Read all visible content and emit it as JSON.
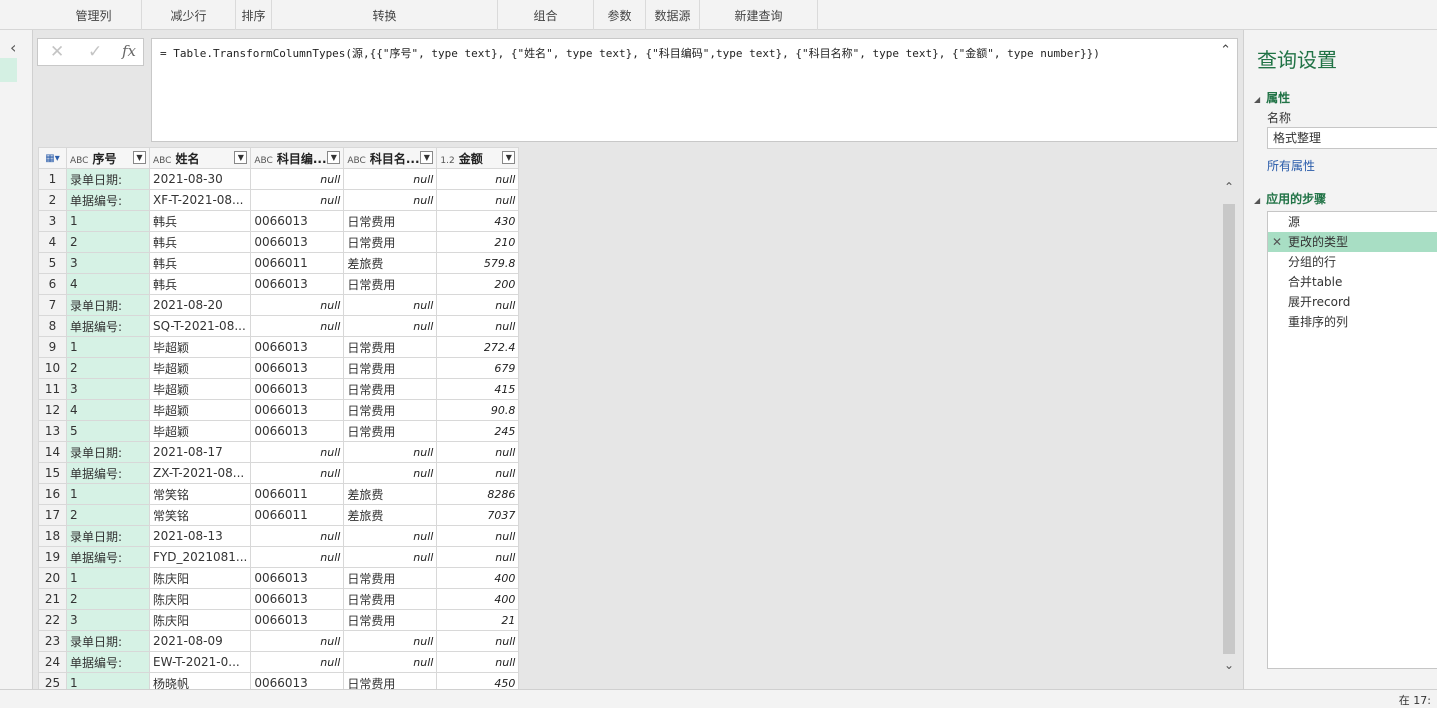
{
  "ribbon": {
    "groups": [
      "管理列",
      "减少行",
      "排序",
      "转换",
      "组合",
      "参数",
      "数据源",
      "新建查询"
    ]
  },
  "formula": {
    "cancel_icon": "✕",
    "commit_icon": "✓",
    "fx_label": "fx",
    "text": "= Table.TransformColumnTypes(源,{{\"序号\", type text}, {\"姓名\", type text}, {\"科目编码\",type text}, {\"科目名称\", type text}, {\"金额\", type number}})"
  },
  "grid": {
    "columns": [
      {
        "type": "ABC",
        "label": "序号"
      },
      {
        "type": "ABC",
        "label": "姓名"
      },
      {
        "type": "ABC",
        "label": "科目编..."
      },
      {
        "type": "ABC",
        "label": "科目名..."
      },
      {
        "type": "1.2",
        "label": "金额"
      }
    ],
    "rows": [
      [
        "1",
        "录单日期:",
        "2021-08-30",
        "null",
        "null",
        "null"
      ],
      [
        "2",
        "单据编号:",
        "XF-T-2021-08...",
        "null",
        "null",
        "null"
      ],
      [
        "3",
        "1",
        "韩兵",
        "0066013",
        "日常费用",
        "430"
      ],
      [
        "4",
        "2",
        "韩兵",
        "0066013",
        "日常费用",
        "210"
      ],
      [
        "5",
        "3",
        "韩兵",
        "0066011",
        "差旅费",
        "579.8"
      ],
      [
        "6",
        "4",
        "韩兵",
        "0066013",
        "日常费用",
        "200"
      ],
      [
        "7",
        "录单日期:",
        "2021-08-20",
        "null",
        "null",
        "null"
      ],
      [
        "8",
        "单据编号:",
        "SQ-T-2021-08...",
        "null",
        "null",
        "null"
      ],
      [
        "9",
        "1",
        "毕超颖",
        "0066013",
        "日常费用",
        "272.4"
      ],
      [
        "10",
        "2",
        "毕超颖",
        "0066013",
        "日常费用",
        "679"
      ],
      [
        "11",
        "3",
        "毕超颖",
        "0066013",
        "日常费用",
        "415"
      ],
      [
        "12",
        "4",
        "毕超颖",
        "0066013",
        "日常费用",
        "90.8"
      ],
      [
        "13",
        "5",
        "毕超颖",
        "0066013",
        "日常费用",
        "245"
      ],
      [
        "14",
        "录单日期:",
        "2021-08-17",
        "null",
        "null",
        "null"
      ],
      [
        "15",
        "单据编号:",
        "ZX-T-2021-08...",
        "null",
        "null",
        "null"
      ],
      [
        "16",
        "1",
        "常笑铭",
        "0066011",
        "差旅费",
        "8286"
      ],
      [
        "17",
        "2",
        "常笑铭",
        "0066011",
        "差旅费",
        "7037"
      ],
      [
        "18",
        "录单日期:",
        "2021-08-13",
        "null",
        "null",
        "null"
      ],
      [
        "19",
        "单据编号:",
        "FYD_2021081...",
        "null",
        "null",
        "null"
      ],
      [
        "20",
        "1",
        "陈庆阳",
        "0066013",
        "日常费用",
        "400"
      ],
      [
        "21",
        "2",
        "陈庆阳",
        "0066013",
        "日常费用",
        "400"
      ],
      [
        "22",
        "3",
        "陈庆阳",
        "0066013",
        "日常费用",
        "21"
      ],
      [
        "23",
        "录单日期:",
        "2021-08-09",
        "null",
        "null",
        "null"
      ],
      [
        "24",
        "单据编号:",
        "EW-T-2021-0...",
        "null",
        "null",
        "null"
      ],
      [
        "25",
        "1",
        "杨晓帆",
        "0066013",
        "日常费用",
        "450"
      ]
    ]
  },
  "query_settings": {
    "title": "查询设置",
    "properties_header": "属性",
    "name_label": "名称",
    "name_value": "格式整理",
    "all_properties_link": "所有属性",
    "steps_header": "应用的步骤",
    "steps": [
      "源",
      "更改的类型",
      "分组的行",
      "合并table",
      "展开record",
      "重排序的列"
    ],
    "selected_step": 1,
    "delete_icon": "✕"
  },
  "status": {
    "text": "在 17:"
  },
  "colors": {
    "accent_green": "#217346",
    "selected_step_bg": "#a8dec4",
    "first_column_bg": "#d6f2e5"
  }
}
